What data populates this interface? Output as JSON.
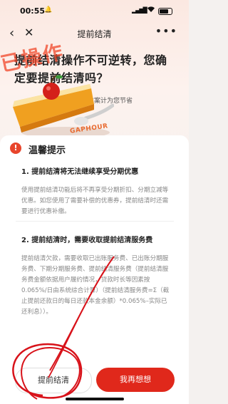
{
  "status_bar": {
    "time": "00:55",
    "bell": "🔔"
  },
  "nav": {
    "back": "‹",
    "close": "✕",
    "title": "提前结清",
    "more": "•••"
  },
  "banner": {
    "headline": "提前结清操作不可逆转，您确定要提前结清吗？",
    "subline": "分期方案计为您节省",
    "watermark": "已操作",
    "gaphour": "GAPHOUR"
  },
  "tips": {
    "icon": "!",
    "title": "温馨提示",
    "sections": [
      {
        "title": "1. 提前结清将无法继续享受分期优惠",
        "body": "使用提前结清功能后将不再享受分期折扣、分期立减等优惠。如您使用了需要补偿的优惠券，提前结清时还需要进行优惠补缴。"
      },
      {
        "title": "2. 提前结清时，需要收取提前结清服务费",
        "body": "提前结清欠款，需要收取已出账服务费、已出账分期服务费、下期分期服务费、提前结清服务费（提前结清服务费金额依据用户履约情况，贷款时长等因素按0.065%/日由系统综合计算）（提前结清服务费=Σ（截止提前还款日的每日还款本金余额）*0.065%–实际已还利息））。"
      }
    ]
  },
  "buttons": {
    "settle": "提前结清",
    "reconsider": "我再想想"
  },
  "colors": {
    "accent": "#e0281b",
    "annotation": "#d8121a"
  }
}
